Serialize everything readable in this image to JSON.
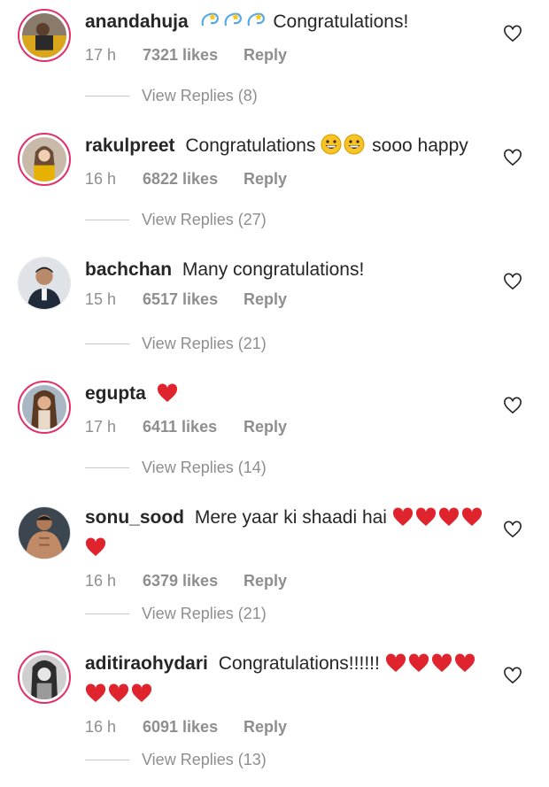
{
  "comments": [
    {
      "username": "anandahuja",
      "text": "Congratulations!",
      "emoji": [
        "dizzy",
        "dizzy",
        "dizzy"
      ],
      "time": "17 h",
      "likes": "7321 likes",
      "reply": "Reply",
      "replies": "View Replies (8)",
      "avatar": "photo-man-car",
      "story_ring": true
    },
    {
      "username": "rakulpreet",
      "text": "Congratulations",
      "emoji": [
        "grin",
        "grin"
      ],
      "text_after": "sooo happy",
      "time": "16 h",
      "likes": "6822 likes",
      "reply": "Reply",
      "replies": "View Replies (27)",
      "avatar": "photo-woman-smiling",
      "story_ring": true
    },
    {
      "username": "bachchan",
      "text": "Many congratulations!",
      "emoji": [],
      "time": "15 h",
      "likes": "6517 likes",
      "reply": "Reply",
      "replies": "View Replies (21)",
      "avatar": "photo-man-suit",
      "story_ring": false
    },
    {
      "username": "egupta",
      "text": "",
      "emoji": [
        "heart"
      ],
      "time": "17 h",
      "likes": "6411 likes",
      "reply": "Reply",
      "replies": "View Replies (14)",
      "avatar": "photo-woman-hair",
      "story_ring": true
    },
    {
      "username": "sonu_sood",
      "text": "Mere yaar ki shaadi hai",
      "emoji": [
        "heart",
        "heart",
        "heart",
        "heart",
        "heart"
      ],
      "time": "16 h",
      "likes": "6379 likes",
      "reply": "Reply",
      "replies": "View Replies (21)",
      "avatar": "photo-man-shirtless",
      "story_ring": false
    },
    {
      "username": "aditiraohydari",
      "text": "Congratulations!!!!!!",
      "emoji": [
        "heart",
        "heart",
        "heart",
        "heart",
        "heart",
        "heart",
        "heart"
      ],
      "time": "16 h",
      "likes": "6091 likes",
      "reply": "Reply",
      "replies": "View Replies (13)",
      "avatar": "photo-woman-bw",
      "story_ring": true
    }
  ],
  "colors": {
    "story_ring": "#e1306c",
    "heart": "#e0242e",
    "meta": "#8e8e8e",
    "text": "#262626"
  },
  "icons": {
    "like": "heart-outline-icon",
    "emoji_heart": "red-heart",
    "emoji_grin": "grinning-face",
    "emoji_dizzy": "dizzy-star"
  }
}
